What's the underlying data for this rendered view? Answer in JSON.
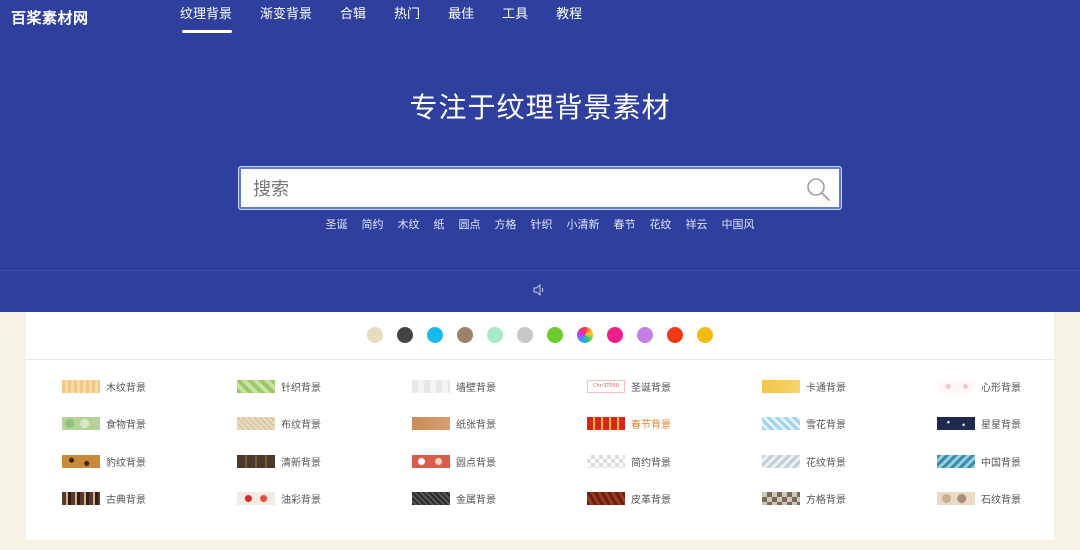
{
  "logo": "百桨素材网",
  "nav": [
    {
      "label": "纹理背景",
      "active": true
    },
    {
      "label": "渐变背景",
      "active": false
    },
    {
      "label": "合辑",
      "active": false
    },
    {
      "label": "热门",
      "active": false
    },
    {
      "label": "最佳",
      "active": false
    },
    {
      "label": "工具",
      "active": false
    },
    {
      "label": "教程",
      "active": false
    }
  ],
  "hero": {
    "headline": "专注于纹理背景素材",
    "search_placeholder": "搜索",
    "tags": [
      "圣诞",
      "简约",
      "木纹",
      "纸",
      "圆点",
      "方格",
      "针织",
      "小清新",
      "春节",
      "花纹",
      "祥云",
      "中国风"
    ]
  },
  "color_swatches": [
    "#e7dcc0",
    "#444444",
    "#18b9ec",
    "#9c8367",
    "#a6ecc6",
    "#c8c8c8",
    "#6ccd2c",
    "rainbow",
    "#f01f8b",
    "#c580e6",
    "#f03a17",
    "#f4bc12"
  ],
  "categories": [
    {
      "label": "木纹背景",
      "thumb": "wood",
      "hot": false
    },
    {
      "label": "针织背景",
      "thumb": "knit",
      "hot": false
    },
    {
      "label": "墙壁背景",
      "thumb": "wall",
      "hot": false
    },
    {
      "label": "圣诞背景",
      "thumb": "christmas",
      "hot": false
    },
    {
      "label": "卡通背景",
      "thumb": "cartoon",
      "hot": false
    },
    {
      "label": "心形背景",
      "thumb": "heart",
      "hot": false
    },
    {
      "label": "食物背景",
      "thumb": "food",
      "hot": false
    },
    {
      "label": "布纹背景",
      "thumb": "cloth",
      "hot": false
    },
    {
      "label": "纸张背景",
      "thumb": "paper",
      "hot": false
    },
    {
      "label": "春节背景",
      "thumb": "spring-festival",
      "hot": true
    },
    {
      "label": "雪花背景",
      "thumb": "snow",
      "hot": false
    },
    {
      "label": "星星背景",
      "thumb": "stars",
      "hot": false
    },
    {
      "label": "豹纹背景",
      "thumb": "leopard",
      "hot": false
    },
    {
      "label": "清新背景",
      "thumb": "fresh",
      "hot": false
    },
    {
      "label": "圆点背景",
      "thumb": "dots",
      "hot": false
    },
    {
      "label": "简约背景",
      "thumb": "simple",
      "hot": false
    },
    {
      "label": "花纹背景",
      "thumb": "floral",
      "hot": false
    },
    {
      "label": "中国背景",
      "thumb": "chinese",
      "hot": false
    },
    {
      "label": "古典背景",
      "thumb": "classic",
      "hot": false
    },
    {
      "label": "油彩背景",
      "thumb": "oil",
      "hot": false
    },
    {
      "label": "金属背景",
      "thumb": "metal",
      "hot": false
    },
    {
      "label": "皮革背景",
      "thumb": "leather",
      "hot": false
    },
    {
      "label": "方格背景",
      "thumb": "checker",
      "hot": false
    },
    {
      "label": "石纹背景",
      "thumb": "stone",
      "hot": false
    }
  ],
  "christmas_thumb_text": "Chr-ST050"
}
